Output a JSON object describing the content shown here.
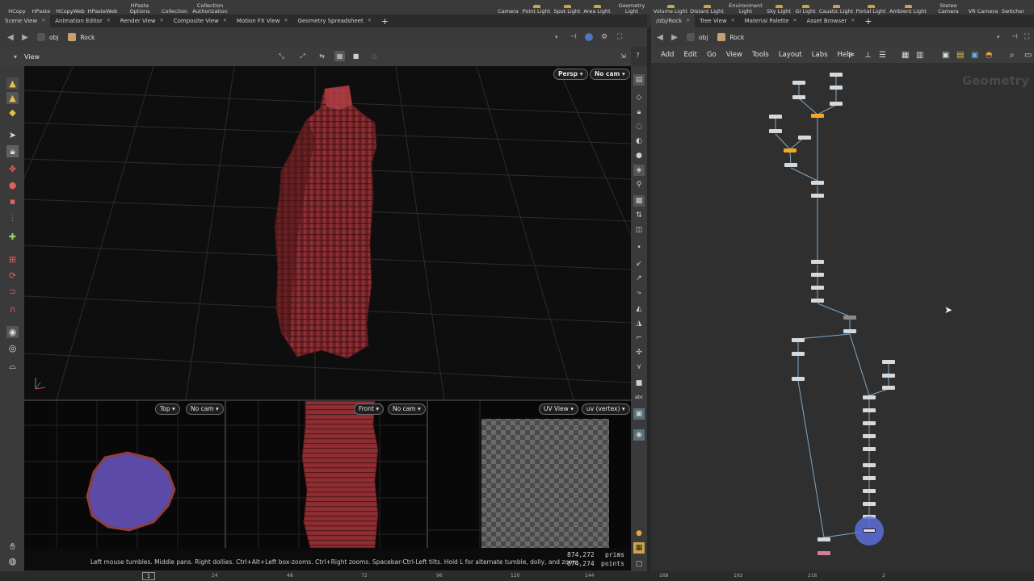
{
  "shelf": {
    "left_tools": [
      "HCopy",
      "HPaste",
      "HCopyWeb",
      "HPasteWeb",
      "HPaste\nOptions",
      "Collection",
      "Collection\nAuthorization"
    ],
    "right_tools": [
      "Camera",
      "Point Light",
      "Spot Light",
      "Area Light",
      "Geometry\nLight",
      "Volume Light",
      "Distant Light",
      "Environment\nLight",
      "Sky Light",
      "GI Light",
      "Caustic Light",
      "Portal Light",
      "Ambient Light",
      "Stereo\nCamera",
      "VR Camera",
      "Switcher"
    ]
  },
  "left_tabs": [
    "Scene View",
    "Animation Editor",
    "Render View",
    "Composite View",
    "Motion FX View",
    "Geometry Spreadsheet"
  ],
  "right_tabs": [
    "/obj/Rock",
    "Tree View",
    "Material Palette",
    "Asset Browser"
  ],
  "left_path": {
    "obj": "obj",
    "node": "Rock"
  },
  "right_path": {
    "obj": "obj",
    "node": "Rock"
  },
  "viewer": {
    "title": "View"
  },
  "viewport_main": {
    "projection": "Persp",
    "camera": "No cam"
  },
  "viewport_top": {
    "projection": "Top",
    "camera": "No cam"
  },
  "viewport_front": {
    "projection": "Front",
    "camera": "No cam"
  },
  "viewport_uv": {
    "projection": "UV View",
    "attribute": "uv (vertex)"
  },
  "status": {
    "message": "Left mouse tumbles. Middle pans. Right dollies. Ctrl+Alt+Left box-zooms. Ctrl+Right zooms. Spacebar-Ctrl-Left tilts. Hold L for alternate tumble, dolly, and zoom.",
    "prims_count": "874,272",
    "prims_label": "prims",
    "points_count": "874,274",
    "points_label": "points"
  },
  "timeline": {
    "frame": "1",
    "ticks": [
      "24",
      "48",
      "72",
      "96",
      "120",
      "144",
      "168",
      "192",
      "216",
      "2"
    ]
  },
  "network": {
    "menu": [
      "Add",
      "Edit",
      "Go",
      "View",
      "Tools",
      "Layout",
      "Labs",
      "Help"
    ],
    "context_label": "Geometry"
  },
  "colors": {
    "accent_orange": "#f3a524",
    "display_flag": "#5a6fd8",
    "rock_red": "#8a2a2a"
  }
}
